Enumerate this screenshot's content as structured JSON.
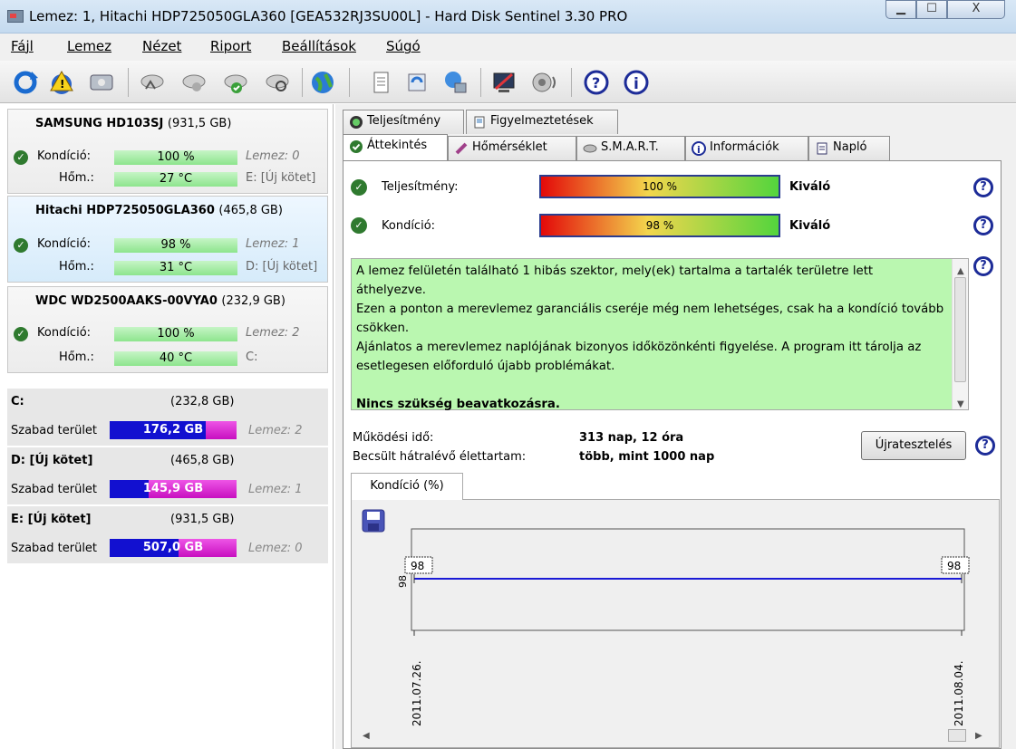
{
  "window": {
    "title": "Lemez: 1, Hitachi HDP725050GLA360 [GEA532RJ3SU00L]  -  Hard Disk Sentinel 3.30 PRO",
    "min": "▁",
    "max": "☐",
    "close": "X"
  },
  "menu": [
    "Fájl",
    "Lemez",
    "Nézet",
    "Riport",
    "Beállítások",
    "Súgó"
  ],
  "disks": [
    {
      "name": "SAMSUNG HD103SJ",
      "size": "(931,5 GB)",
      "cond_label": "Kondíció:",
      "cond": "100 %",
      "cond_extra": "Lemez: 0",
      "temp_label": "Hőm.:",
      "temp": "27 °C",
      "temp_extra": "E: [Új kötet]"
    },
    {
      "name": "Hitachi HDP725050GLA360",
      "size": "(465,8 GB)",
      "cond_label": "Kondíció:",
      "cond": "98 %",
      "cond_extra": "Lemez: 1",
      "temp_label": "Hőm.:",
      "temp": "31 °C",
      "temp_extra": "D: [Új kötet]"
    },
    {
      "name": "WDC WD2500AAKS-00VYA0",
      "size": "(232,9 GB)",
      "cond_label": "Kondíció:",
      "cond": "100 %",
      "cond_extra": "Lemez: 2",
      "temp_label": "Hőm.:",
      "temp": "40 °C",
      "temp_extra": "C:"
    }
  ],
  "volumes": [
    {
      "name": "C:",
      "size": "(232,8 GB)",
      "free_label": "Szabad terület",
      "free": "176,2 GB",
      "free_fraction": 0.24,
      "disk": "Lemez: 2"
    },
    {
      "name": "D: [Új kötet]",
      "size": "(465,8 GB)",
      "free_label": "Szabad terület",
      "free": "145,9 GB",
      "free_fraction": 0.69,
      "disk": "Lemez: 1"
    },
    {
      "name": "E: [Új kötet]",
      "size": "(931,5 GB)",
      "free_label": "Szabad terület",
      "free": "507,0 GB",
      "free_fraction": 0.46,
      "disk": "Lemez: 0"
    }
  ],
  "tabs_top": [
    "Teljesítmény",
    "Figyelmeztetések"
  ],
  "tabs_bottom": [
    "Áttekintés",
    "Hőmérséklet",
    "S.M.A.R.T.",
    "Információk",
    "Napló"
  ],
  "overview": {
    "perf_label": "Teljesítmény:",
    "perf_value": "100 %",
    "perf_rating": "Kiváló",
    "cond_label": "Kondíció:",
    "cond_value": "98 %",
    "cond_rating": "Kiváló",
    "message": [
      "A lemez felületén található 1 hibás szektor, mely(ek) tartalma a tartalék területre lett áthelyezve.",
      "Ezen a ponton a merevlemez garanciális cseréje még nem lehetséges, csak ha a kondíció tovább csökken.",
      "Ajánlatos a merevlemez naplójának bizonyos időközönkénti figyelése. A program itt tárolja az esetlegesen előforduló újabb problémákat.",
      "Nincs szükség beavatkozásra."
    ],
    "uptime_label": "Működési idő:",
    "uptime": "313 nap, 12 óra",
    "life_label": "Becsült hátralévő élettartam:",
    "life": "több, mint 1000 nap",
    "retest": "Újratesztelés",
    "help": "?"
  },
  "chart": {
    "tab": "Kondíció  (%)"
  },
  "chart_data": {
    "type": "line",
    "x": [
      "2011.07.26.",
      "2011.08.04."
    ],
    "series": [
      {
        "values": [
          98,
          98
        ]
      }
    ],
    "data_labels": [
      "98",
      "98"
    ],
    "y_tick": "98",
    "color": "#1a1ad6"
  }
}
